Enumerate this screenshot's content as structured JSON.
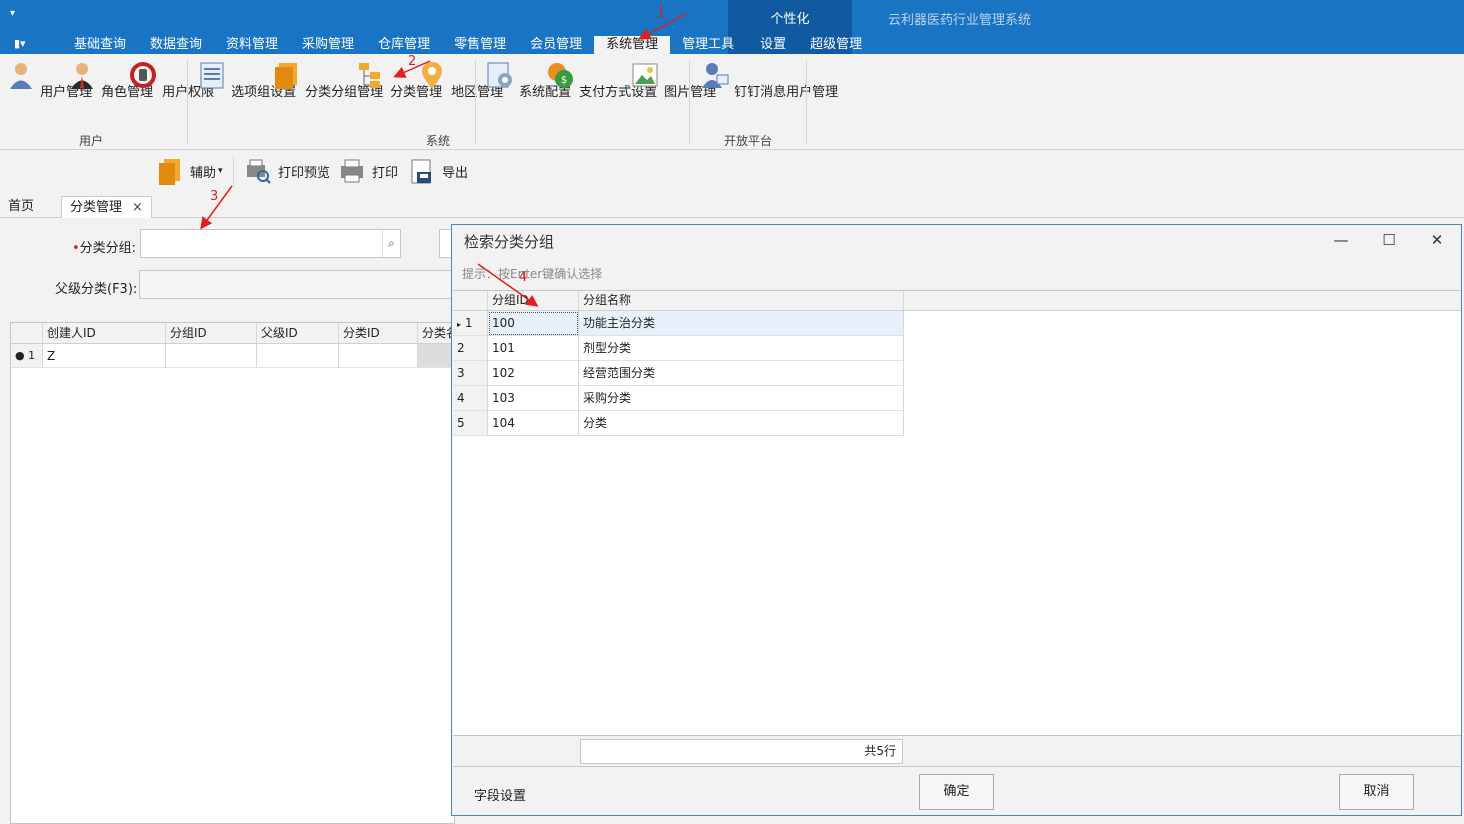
{
  "titlebar": {
    "app_title": "云利器医药行业管理系统",
    "context_group_title": "个性化",
    "tabs": [
      "基础查询",
      "数据查询",
      "资料管理",
      "采购管理",
      "仓库管理",
      "零售管理",
      "会员管理",
      "系统管理",
      "管理工具",
      "设置",
      "超级管理"
    ],
    "active_tab": "系统管理"
  },
  "ribbon": {
    "groups": {
      "user": "用户",
      "system": "系统",
      "open": "开放平台"
    },
    "buttons": {
      "user_mgmt": "用户管理",
      "role_mgmt": "角色管理",
      "user_perm": "用户权限",
      "option_group": "选项组设置",
      "cat_group_mgmt": "分类分组管理",
      "cat_mgmt": "分类管理",
      "region_mgmt": "地区管理",
      "sys_config": "系统配置",
      "payment": "支付方式设置",
      "image_mgmt": "图片管理",
      "dingtalk": "钉钉消息用户管理"
    }
  },
  "toolbar": {
    "assist": "辅助",
    "print_preview": "打印预览",
    "print": "打印",
    "export": "导出"
  },
  "doctabs": {
    "home": "首页",
    "current": "分类管理",
    "close": "×"
  },
  "form": {
    "required_mark": "•",
    "category_group_label": "分类分组:",
    "parent_label": "父级分类(F3):"
  },
  "main_grid": {
    "columns": [
      "创建人ID",
      "分组ID",
      "父级ID",
      "分类ID",
      "分类名"
    ],
    "row_num": "1",
    "row_first_cell": "Z"
  },
  "dialog": {
    "title": "检索分类分组",
    "hint": "提示：按Enter键确认选择",
    "columns": [
      "分组ID",
      "分组名称"
    ],
    "rows": [
      {
        "n": "1",
        "id": "100",
        "name": "功能主治分类"
      },
      {
        "n": "2",
        "id": "101",
        "name": "剂型分类"
      },
      {
        "n": "3",
        "id": "102",
        "name": "经营范围分类"
      },
      {
        "n": "4",
        "id": "103",
        "name": "采购分类"
      },
      {
        "n": "5",
        "id": "104",
        "name": "分类"
      }
    ],
    "count": "共5行",
    "field_settings": "字段设置",
    "ok": "确定",
    "cancel": "取消"
  },
  "annotations": [
    "1",
    "2",
    "3",
    "4"
  ],
  "colors": {
    "ribbon_blue": "#1a74c4",
    "context_blue": "#0f5aa0",
    "annotation_red": "#e02020"
  }
}
